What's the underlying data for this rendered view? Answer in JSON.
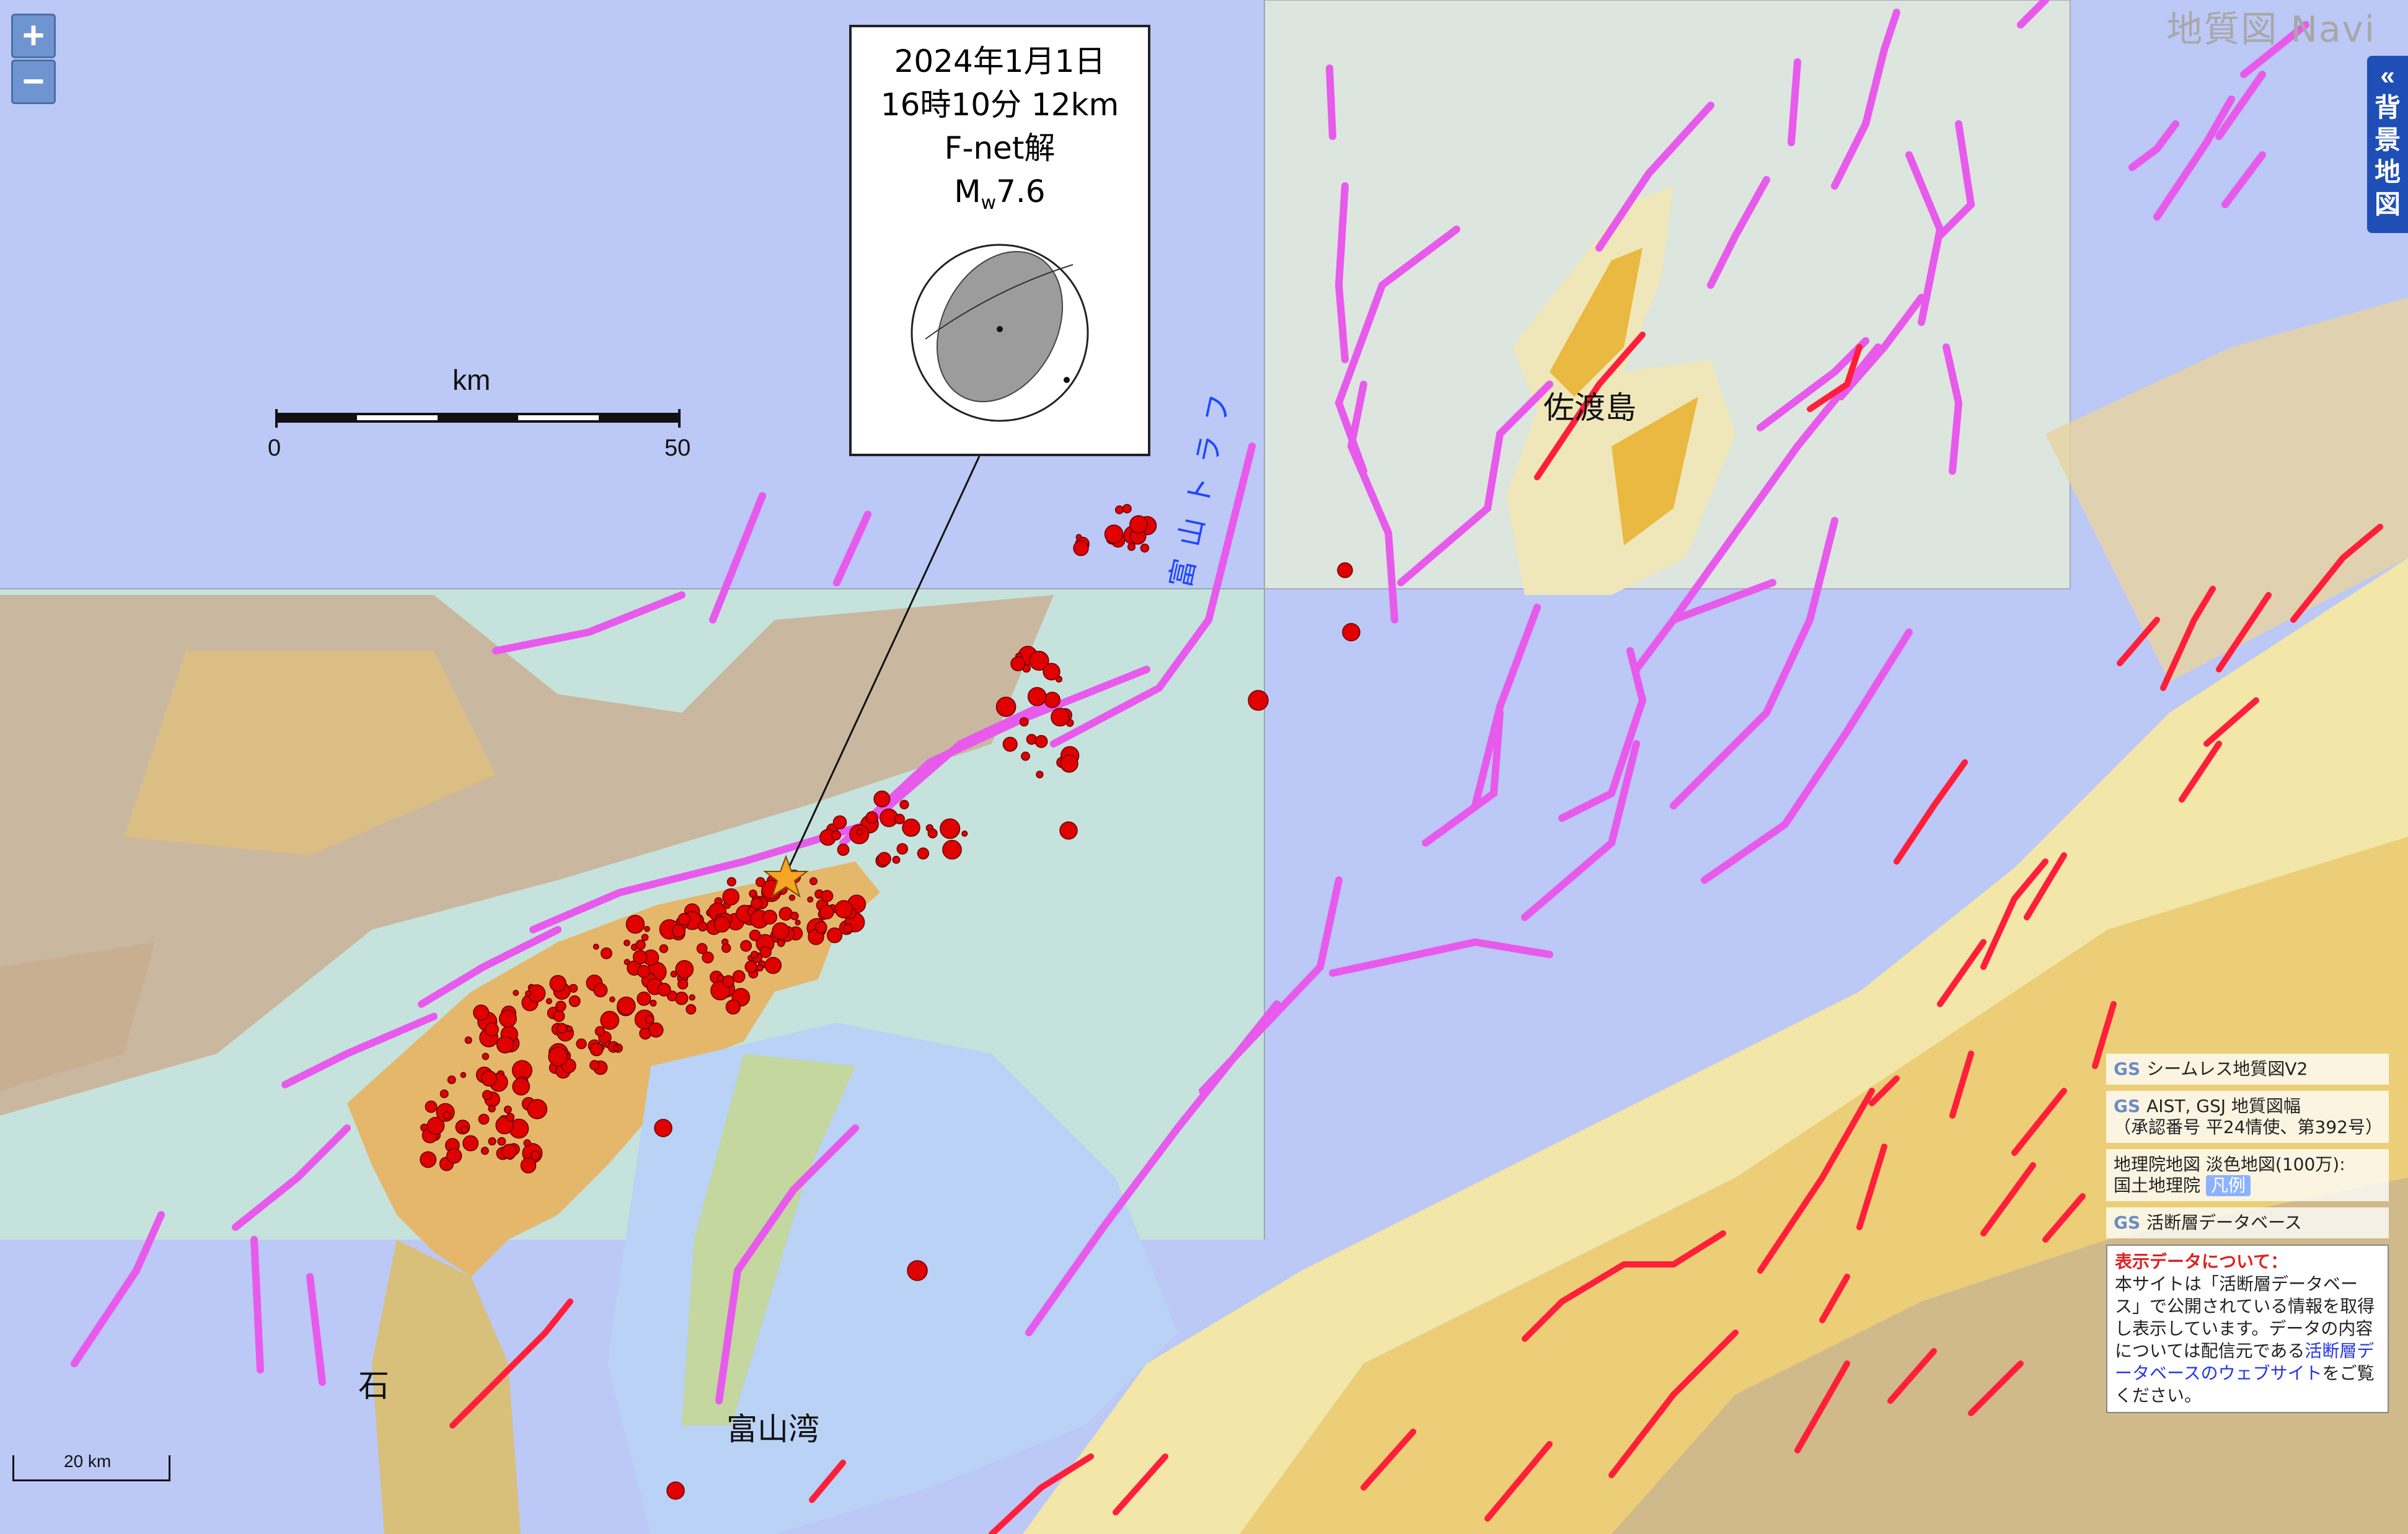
{
  "map": {
    "watermark": "地質図 Navi",
    "zoom_in": "+",
    "zoom_out": "−",
    "background_toggle": {
      "arrow": "«",
      "chars": [
        "背",
        "景",
        "地",
        "図"
      ]
    }
  },
  "callout": {
    "date": "2024年1月1日",
    "time_depth": "16時10分 12km",
    "solution": "F-net解",
    "magnitude_prefix": "M",
    "magnitude_sub": "w",
    "magnitude_value": "7.6"
  },
  "scale_bars": {
    "large_title": "km",
    "large_min": "0",
    "large_max": "50",
    "small_label": "20 km"
  },
  "labels": {
    "sado": "佐渡島",
    "toyama_bay": "富山湾",
    "toyama_trough": "富山トラフ",
    "ishikawa": "石"
  },
  "attribution": {
    "seamless": "シームレス地質図V2",
    "aist": "AIST, GSJ 地質図幅",
    "aist_note": "（承認番号 平24情使、第392号）",
    "gsi": "地理院地図 淡色地図(100万):",
    "gsi_org": "国土地理院",
    "legend": "凡例",
    "fault_db": "活断層データベース",
    "info_title": "表示データについて：",
    "info_body": "本サイトは「活断層データベース」で公開されている情報を取得し表示しています。データの内容については配信元である",
    "info_link": "活断層データベースのウェブサイト",
    "info_tail": "をご覧ください。",
    "gs_mark": "GS"
  },
  "colors": {
    "sea": "#bcc8f6",
    "fault_active": "#ff1f3a",
    "fault_offshore": "#e85aec",
    "aftershock": "#e00000",
    "epicenter": "#f6a623"
  }
}
